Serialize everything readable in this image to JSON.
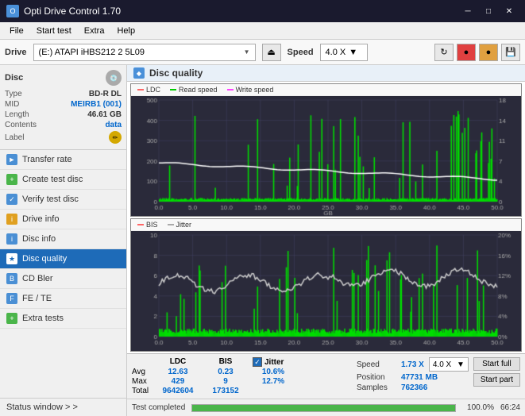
{
  "titlebar": {
    "title": "Opti Drive Control 1.70",
    "controls": [
      "minimize",
      "maximize",
      "close"
    ]
  },
  "menubar": {
    "items": [
      "File",
      "Start test",
      "Extra",
      "Help"
    ]
  },
  "drivebar": {
    "drive_label": "Drive",
    "drive_value": "(E:) ATAPI iHBS212  2 5L09",
    "speed_label": "Speed",
    "speed_value": "4.0 X"
  },
  "disc": {
    "title": "Disc",
    "type_label": "Type",
    "type_value": "BD-R DL",
    "mid_label": "MID",
    "mid_value": "MEIRB1 (001)",
    "length_label": "Length",
    "length_value": "46.61 GB",
    "contents_label": "Contents",
    "contents_value": "data",
    "label_label": "Label"
  },
  "nav": {
    "items": [
      {
        "id": "transfer-rate",
        "label": "Transfer rate",
        "icon": "►"
      },
      {
        "id": "create-test-disc",
        "label": "Create test disc",
        "icon": "+"
      },
      {
        "id": "verify-test-disc",
        "label": "Verify test disc",
        "icon": "✓"
      },
      {
        "id": "drive-info",
        "label": "Drive info",
        "icon": "i"
      },
      {
        "id": "disc-info",
        "label": "Disc info",
        "icon": "i"
      },
      {
        "id": "disc-quality",
        "label": "Disc quality",
        "icon": "★",
        "active": true
      },
      {
        "id": "cd-bler",
        "label": "CD Bler",
        "icon": "B"
      },
      {
        "id": "fe-te",
        "label": "FE / TE",
        "icon": "F"
      },
      {
        "id": "extra-tests",
        "label": "Extra tests",
        "icon": "+"
      }
    ],
    "status_window": "Status window > >"
  },
  "chart": {
    "title": "Disc quality",
    "top_legend": [
      {
        "id": "ldc",
        "label": "LDC",
        "color": "#ff4444"
      },
      {
        "id": "read",
        "label": "Read speed",
        "color": "#00ee00"
      },
      {
        "id": "write",
        "label": "Write speed",
        "color": "#ff44ff"
      }
    ],
    "bottom_legend": [
      {
        "id": "bis",
        "label": "BIS",
        "color": "#ff4444"
      },
      {
        "id": "jitter",
        "label": "Jitter",
        "color": "#aaaaaa"
      }
    ],
    "top_y_left_max": 500,
    "top_y_right_max": 18,
    "bottom_y_left_max": 10,
    "bottom_y_right_max": 20,
    "x_max": 50
  },
  "stats": {
    "columns": [
      "LDC",
      "BIS"
    ],
    "jitter_label": "Jitter",
    "jitter_checked": true,
    "rows": [
      {
        "label": "Avg",
        "ldc": "12.63",
        "bis": "0.23",
        "jitter": "10.6%"
      },
      {
        "label": "Max",
        "ldc": "429",
        "bis": "9",
        "jitter": "12.7%"
      },
      {
        "label": "Total",
        "ldc": "9642604",
        "bis": "173152",
        "jitter": ""
      }
    ],
    "speed_label": "Speed",
    "speed_value": "1.73 X",
    "speed_select": "4.0 X",
    "position_label": "Position",
    "position_value": "47731 MB",
    "samples_label": "Samples",
    "samples_value": "762366",
    "start_full": "Start full",
    "start_part": "Start part"
  },
  "statusbar": {
    "status_text": "Test completed",
    "progress": 100,
    "progress_text": "100.0%",
    "time": "66:24"
  }
}
